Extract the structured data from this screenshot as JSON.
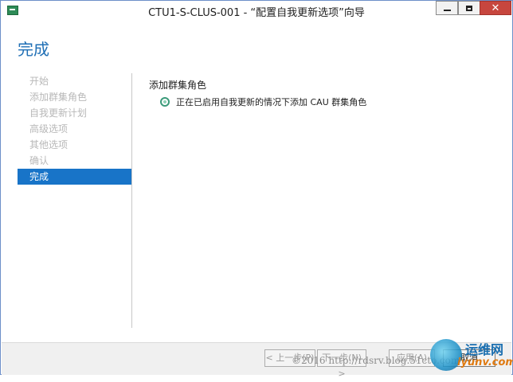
{
  "window": {
    "title": "CTU1-S-CLUS-001 - “配置自我更新选项”向导",
    "controls": {
      "minimize": "minimize",
      "maximize": "maximize",
      "close": "✕"
    }
  },
  "page": {
    "title": "完成"
  },
  "nav": {
    "items": [
      {
        "label": "开始",
        "state": "disabled"
      },
      {
        "label": "添加群集角色",
        "state": "disabled"
      },
      {
        "label": "自我更新计划",
        "state": "disabled"
      },
      {
        "label": "高级选项",
        "state": "disabled"
      },
      {
        "label": "其他选项",
        "state": "disabled"
      },
      {
        "label": "确认",
        "state": "disabled"
      },
      {
        "label": "完成",
        "state": "active"
      }
    ]
  },
  "main": {
    "section_title": "添加群集角色",
    "status_icon": "progress-spinner-icon",
    "status_text": "正在已启用自我更新的情况下添加 CAU 群集角色"
  },
  "footer": {
    "prev_label": "< 上一步(P)",
    "next_label": "下一步(N) >",
    "apply_label": "应用(A)",
    "cancel_label": "取消"
  },
  "watermark": {
    "copyright": "©2016 http://rdsrv.blog.51cto.com",
    "site_cn": "运维网",
    "site_en": "iyunv.com"
  },
  "colors": {
    "accent": "#1874c8",
    "title_blue": "#1f6fb5",
    "close_red": "#c7463e",
    "disabled_text": "#b8b8b8"
  }
}
